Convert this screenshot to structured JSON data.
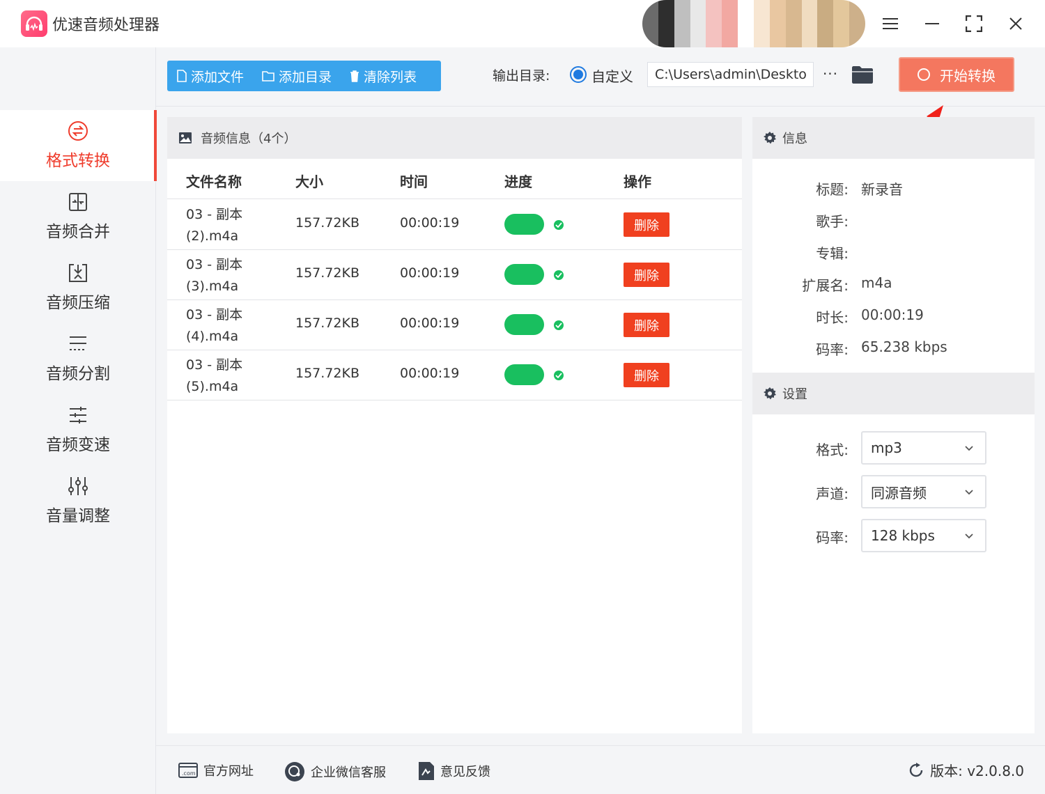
{
  "window": {
    "title": "优速音频处理器",
    "user_blur_colors": [
      "#6b6b6b",
      "#2e2e2e",
      "#bfbfbf",
      "#e8e8e8",
      "#f4c2c0",
      "#f2a8a2",
      "#ffffff",
      "#f7e6d2",
      "#e9c7a1",
      "#d8b890",
      "#f0dcc0",
      "#c9ac82",
      "#e3c79c",
      "#cdb08a"
    ]
  },
  "sidebar": {
    "items": [
      {
        "label": "格式转换",
        "active": true
      },
      {
        "label": "音频合并"
      },
      {
        "label": "音频压缩"
      },
      {
        "label": "音频分割"
      },
      {
        "label": "音频变速"
      },
      {
        "label": "音量调整"
      }
    ]
  },
  "toolbar": {
    "add_file": "添加文件",
    "add_dir": "添加目录",
    "clear_list": "清除列表",
    "output_label": "输出目录:",
    "radio_label": "自定义",
    "path_value": "C:\\Users\\admin\\Deskto",
    "more": "···",
    "start": "开始转换"
  },
  "list": {
    "title": "音频信息（4个）",
    "columns": {
      "name": "文件名称",
      "size": "大小",
      "time": "时间",
      "progress": "进度",
      "action": "操作"
    },
    "rows": [
      {
        "name": "03 - 副本 (2).m4a",
        "size": "157.72KB",
        "time": "00:00:19",
        "action": "删除"
      },
      {
        "name": "03 - 副本 (3).m4a",
        "size": "157.72KB",
        "time": "00:00:19",
        "action": "删除"
      },
      {
        "name": "03 - 副本 (4).m4a",
        "size": "157.72KB",
        "time": "00:00:19",
        "action": "删除"
      },
      {
        "name": "03 - 副本 (5).m4a",
        "size": "157.72KB",
        "time": "00:00:19",
        "action": "删除"
      }
    ]
  },
  "info": {
    "header": "信息",
    "fields": [
      {
        "label": "标题:",
        "value": "新录音"
      },
      {
        "label": "歌手:",
        "value": ""
      },
      {
        "label": "专辑:",
        "value": ""
      },
      {
        "label": "扩展名:",
        "value": "m4a"
      },
      {
        "label": "时长:",
        "value": "00:00:19"
      },
      {
        "label": "码率:",
        "value": "65.238 kbps"
      }
    ]
  },
  "settings": {
    "header": "设置",
    "format_label": "格式:",
    "format_value": "mp3",
    "channel_label": "声道:",
    "channel_value": "同源音频",
    "bitrate_label": "码率:",
    "bitrate_value": "128 kbps"
  },
  "footer": {
    "website": "官方网址",
    "wechat": "企业微信客服",
    "feedback": "意见反馈",
    "version": "版本:  v2.0.8.0"
  },
  "colors": {
    "accent_blue": "#3aa4ec",
    "start_button": "#f4775f",
    "delete_button": "#f0401f",
    "progress_green": "#19bf5f",
    "active_sidebar": "#ef3c2c"
  }
}
